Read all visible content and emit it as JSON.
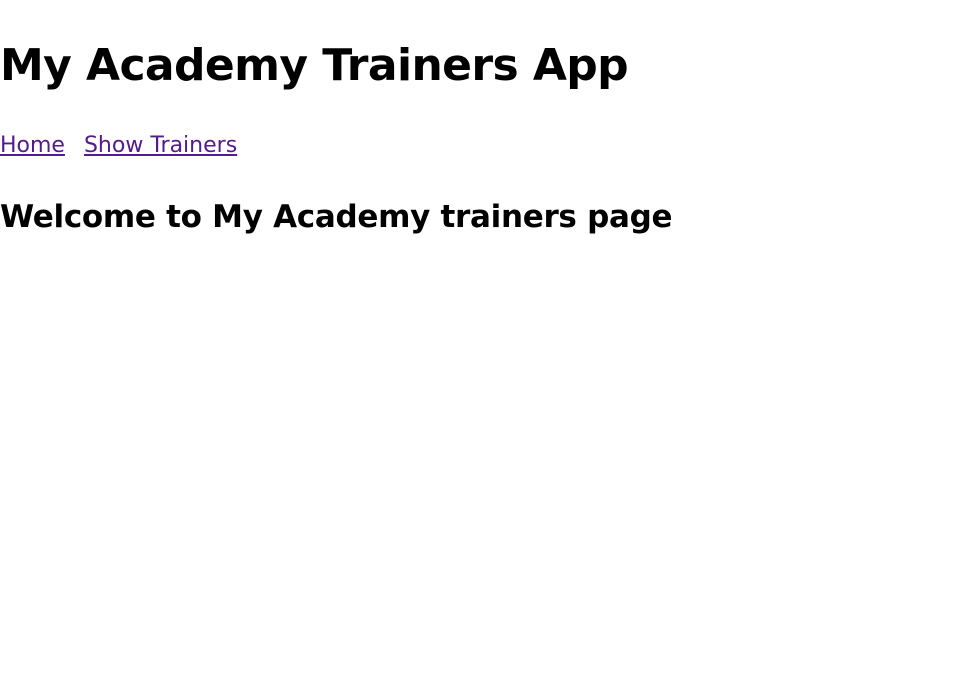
{
  "header": {
    "title": "My Academy Trainers App"
  },
  "nav": {
    "links": [
      {
        "label": "Home"
      },
      {
        "label": "Show Trainers"
      }
    ]
  },
  "main": {
    "heading": "Welcome to My Academy trainers page"
  },
  "colors": {
    "link_visited": "#551a8b",
    "text": "#000000",
    "background": "#ffffff"
  }
}
